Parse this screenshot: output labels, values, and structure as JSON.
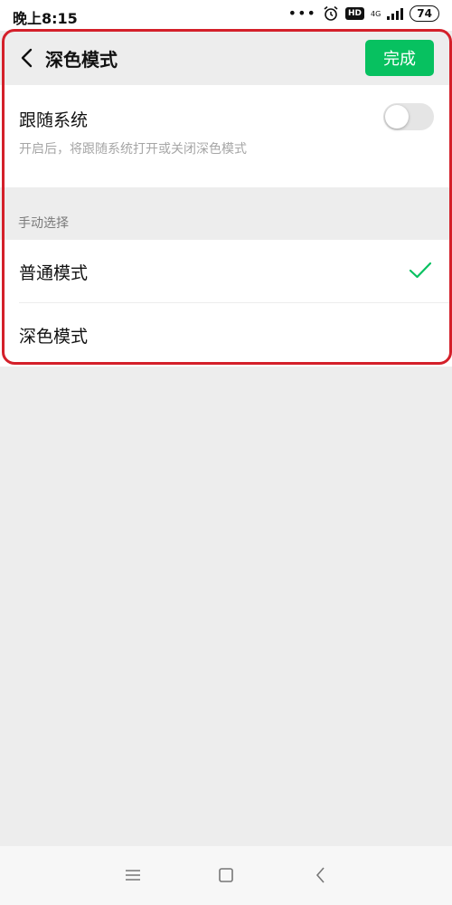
{
  "status_bar": {
    "time": "晚上8:15",
    "dots": "•••",
    "hd": "HD",
    "network": "4G",
    "battery": "74",
    "icons": [
      "dots-icon",
      "alarm-icon",
      "hd-icon",
      "signal-icon",
      "battery-icon"
    ]
  },
  "nav": {
    "title": "深色模式",
    "done_label": "完成",
    "accent_color": "#07c160"
  },
  "follow_system": {
    "label": "跟随系统",
    "description": "开启后，将跟随系统打开或关闭深色模式",
    "enabled": false
  },
  "manual": {
    "section_title": "手动选择",
    "options": [
      {
        "label": "普通模式",
        "selected": true
      },
      {
        "label": "深色模式",
        "selected": false
      }
    ]
  },
  "bottom_nav": {
    "icons": [
      "menu-icon",
      "home-icon",
      "back-icon"
    ]
  },
  "highlight_color": "#d4202a"
}
